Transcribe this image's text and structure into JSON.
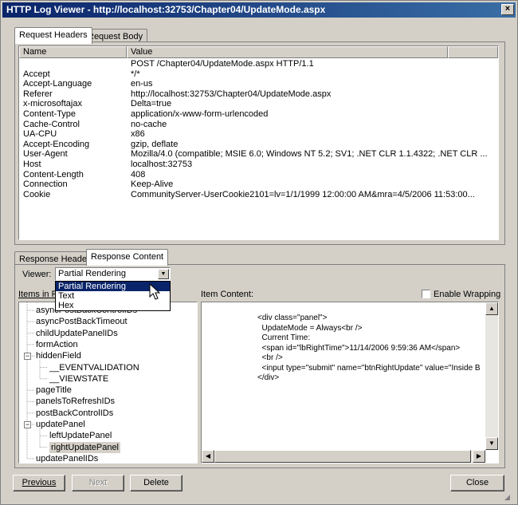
{
  "window": {
    "title": "HTTP Log Viewer - http://localhost:32753/Chapter04/UpdateMode.aspx",
    "close": "×"
  },
  "request_tabs": [
    "Request Headers",
    "Request Body"
  ],
  "headers_table": {
    "columns": [
      "Name",
      "Value"
    ],
    "rows": [
      {
        "name": "",
        "value": "POST /Chapter04/UpdateMode.aspx HTTP/1.1"
      },
      {
        "name": "Accept",
        "value": "*/*"
      },
      {
        "name": "Accept-Language",
        "value": "en-us"
      },
      {
        "name": "Referer",
        "value": "http://localhost:32753/Chapter04/UpdateMode.aspx"
      },
      {
        "name": "x-microsoftajax",
        "value": "Delta=true"
      },
      {
        "name": "Content-Type",
        "value": "application/x-www-form-urlencoded"
      },
      {
        "name": "Cache-Control",
        "value": "no-cache"
      },
      {
        "name": "UA-CPU",
        "value": "x86"
      },
      {
        "name": "Accept-Encoding",
        "value": "gzip, deflate"
      },
      {
        "name": "User-Agent",
        "value": "Mozilla/4.0 (compatible; MSIE 6.0; Windows NT 5.2; SV1; .NET CLR 1.1.4322; .NET CLR ..."
      },
      {
        "name": "Host",
        "value": "localhost:32753"
      },
      {
        "name": "Content-Length",
        "value": "408"
      },
      {
        "name": "Connection",
        "value": "Keep-Alive"
      },
      {
        "name": "Cookie",
        "value": "CommunityServer-UserCookie2101=lv=1/1/1999 12:00:00 AM&mra=4/5/2006 11:53:00..."
      }
    ]
  },
  "response_tabs": [
    "Response Headers",
    "Response Content"
  ],
  "viewer": {
    "label": "Viewer:",
    "selected": "Partial Rendering",
    "options": [
      "Partial Rendering",
      "Text",
      "Hex"
    ]
  },
  "items_label": "Items in Re",
  "tree": [
    {
      "label": "asyncPostBackControlIDs",
      "indent": 0
    },
    {
      "label": "asyncPostBackTimeout",
      "indent": 0
    },
    {
      "label": "childUpdatePanelIDs",
      "indent": 0
    },
    {
      "label": "formAction",
      "indent": 0
    },
    {
      "label": "hiddenField",
      "indent": 0,
      "expander": "−"
    },
    {
      "label": "__EVENTVALIDATION",
      "indent": 1
    },
    {
      "label": "__VIEWSTATE",
      "indent": 1
    },
    {
      "label": "pageTitle",
      "indent": 0
    },
    {
      "label": "panelsToRefreshIDs",
      "indent": 0
    },
    {
      "label": "postBackControlIDs",
      "indent": 0
    },
    {
      "label": "updatePanel",
      "indent": 0,
      "expander": "−"
    },
    {
      "label": "leftUpdatePanel",
      "indent": 1
    },
    {
      "label": "rightUpdatePanel",
      "indent": 1,
      "selected": true
    },
    {
      "label": "updatePanelIDs",
      "indent": 0
    }
  ],
  "item_content_label": "Item Content:",
  "enable_wrapping": "Enable Wrapping",
  "item_content": "<div class=\"panel\">\n  UpdateMode = Always<br />\n  Current Time:\n  <span id=\"lbRightTime\">11/14/2006 9:59:36 AM</span>\n  <br />\n  <input type=\"submit\" name=\"btnRightUpdate\" value=\"Inside B\n</div>",
  "buttons": {
    "previous": "Previous",
    "next": "Next",
    "delete": "Delete",
    "close": "Close"
  }
}
